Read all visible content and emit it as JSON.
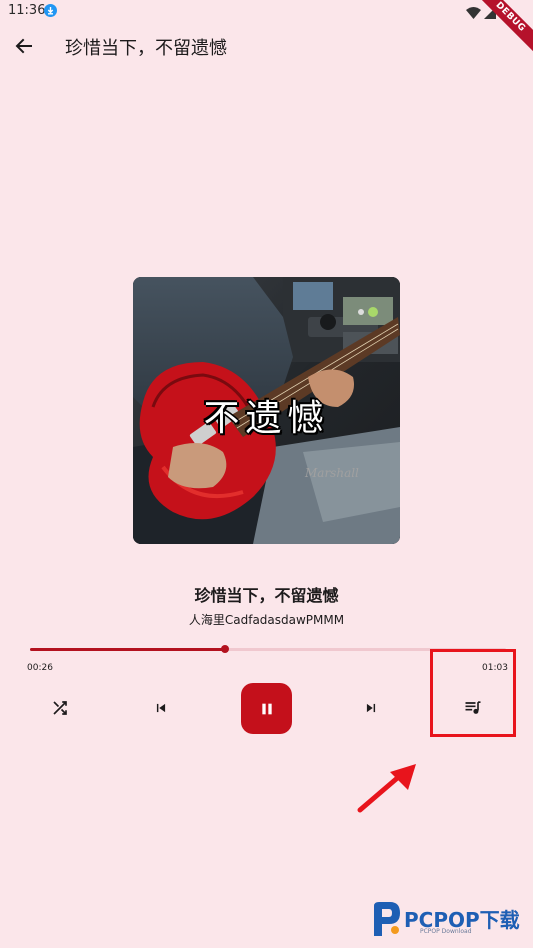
{
  "status_bar": {
    "time": "11:36"
  },
  "debug_banner": "DEBUG",
  "app_bar": {
    "title": "珍惜当下，不留遗憾"
  },
  "album_art": {
    "caption": "不遗憾"
  },
  "song": {
    "title": "珍惜当下，不留遗憾",
    "artist": "人海里CadfadasdawPMMM"
  },
  "playback": {
    "current_time": "00:26",
    "total_time": "01:03",
    "progress": 0.41,
    "state": "playing"
  },
  "controls": [
    "shuffle-icon",
    "skip-previous-icon",
    "pause-icon",
    "skip-next-icon",
    "queue-music-icon"
  ],
  "colors": {
    "background": "#fbe6ea",
    "accent": "#c4101b",
    "highlight": "#e8141c",
    "watermark": "#1e5fb4"
  },
  "watermark": {
    "brand": "PCPOP下载",
    "sub": "PCPOP Download"
  }
}
